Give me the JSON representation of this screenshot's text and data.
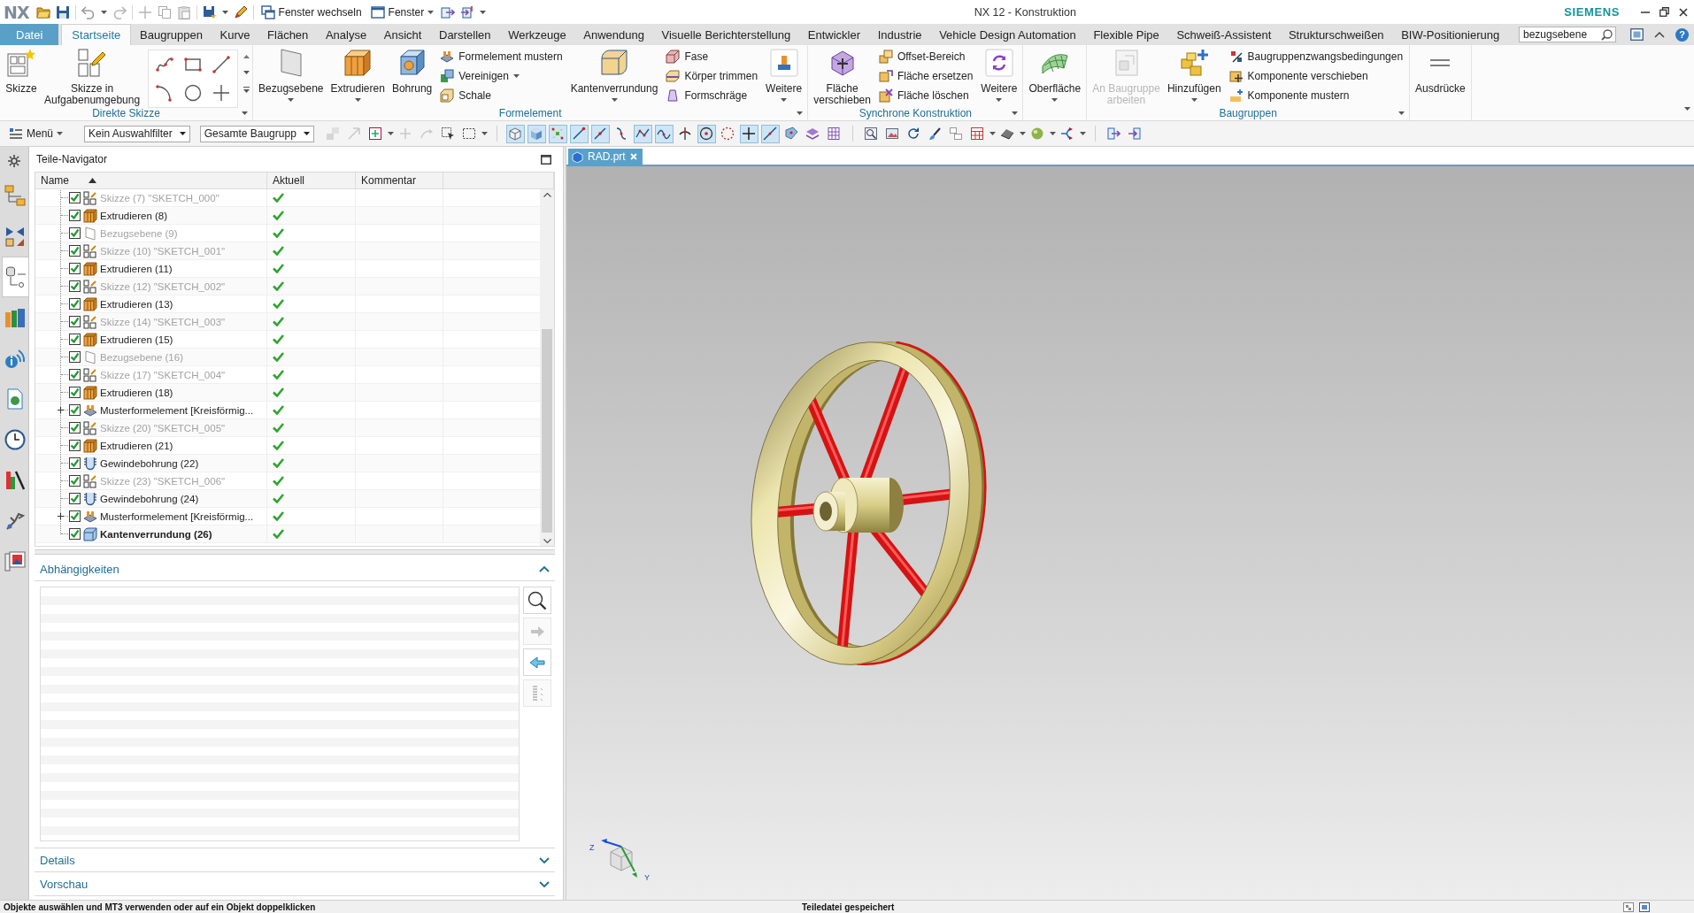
{
  "title_bar": {
    "logo": "NX",
    "quick_access": [
      {
        "label": "Fenster wechseln",
        "dropdown": false
      },
      {
        "label": "Fenster",
        "dropdown": true
      }
    ],
    "title": "NX 12 - Konstruktion",
    "brand": "SIEMENS"
  },
  "ribbon_tabs": [
    {
      "label": "Datei",
      "kind": "file",
      "selected": false
    },
    {
      "label": "Startseite",
      "kind": "tab",
      "selected": true
    },
    {
      "label": "Baugruppen",
      "kind": "tab",
      "selected": false
    },
    {
      "label": "Kurve",
      "kind": "tab",
      "selected": false
    },
    {
      "label": "Flächen",
      "kind": "tab",
      "selected": false
    },
    {
      "label": "Analyse",
      "kind": "tab",
      "selected": false
    },
    {
      "label": "Ansicht",
      "kind": "tab",
      "selected": false
    },
    {
      "label": "Darstellen",
      "kind": "tab",
      "selected": false
    },
    {
      "label": "Werkzeuge",
      "kind": "tab",
      "selected": false
    },
    {
      "label": "Anwendung",
      "kind": "tab",
      "selected": false
    },
    {
      "label": "Visuelle Berichterstellung",
      "kind": "tab",
      "selected": false
    },
    {
      "label": "Entwickler",
      "kind": "tab",
      "selected": false
    },
    {
      "label": "Industrie",
      "kind": "tab",
      "selected": false
    },
    {
      "label": "Vehicle Design Automation",
      "kind": "tab",
      "selected": false
    },
    {
      "label": "Flexible Pipe",
      "kind": "tab",
      "selected": false
    },
    {
      "label": "Schweiß-Assistent",
      "kind": "tab",
      "selected": false
    },
    {
      "label": "Strukturschweißen",
      "kind": "tab",
      "selected": false
    },
    {
      "label": "BIW-Positionierung",
      "kind": "tab",
      "selected": false
    }
  ],
  "command_search": {
    "value": "bezugsebene"
  },
  "help": "?",
  "ribbon_groups": [
    {
      "label": "Direkte Skizze",
      "launcher": true,
      "items": [
        {
          "kind": "large",
          "label": "Skizze",
          "dropdown": false,
          "disabled": false
        },
        {
          "kind": "large",
          "label": "Skizze in Aufgabenumgebung",
          "dropdown": false,
          "disabled": false
        },
        {
          "kind": "gallery"
        }
      ]
    },
    {
      "label": "Formelement",
      "launcher": true,
      "items": [
        {
          "kind": "large",
          "label": "Bezugsebene",
          "dropdown": true,
          "disabled": false
        },
        {
          "kind": "large",
          "label": "Extrudieren",
          "dropdown": true,
          "disabled": false
        },
        {
          "kind": "large",
          "label": "Bohrung",
          "dropdown": false,
          "disabled": false
        },
        {
          "kind": "stack",
          "entries": [
            {
              "label": "Formelement mustern",
              "dropdown": false
            },
            {
              "label": "Vereinigen",
              "dropdown": true
            },
            {
              "label": "Schale",
              "dropdown": false
            }
          ]
        },
        {
          "kind": "large",
          "label": "Kantenverrundung",
          "dropdown": true,
          "disabled": false
        },
        {
          "kind": "stack",
          "entries": [
            {
              "label": "Fase",
              "dropdown": false
            },
            {
              "label": "Körper trimmen",
              "dropdown": false
            },
            {
              "label": "Formschräge",
              "dropdown": false
            }
          ]
        },
        {
          "kind": "large",
          "label": "Weitere",
          "dropdown": true,
          "disabled": false
        }
      ]
    },
    {
      "label": "Synchrone Konstruktion",
      "launcher": true,
      "items": [
        {
          "kind": "large",
          "label": "Fläche verschieben",
          "dropdown": false,
          "disabled": false
        },
        {
          "kind": "stack",
          "entries": [
            {
              "label": "Offset-Bereich",
              "dropdown": false
            },
            {
              "label": "Fläche ersetzen",
              "dropdown": false
            },
            {
              "label": "Fläche löschen",
              "dropdown": false
            }
          ]
        },
        {
          "kind": "large",
          "label": "Weitere",
          "dropdown": true,
          "disabled": false
        }
      ]
    },
    {
      "launcher": false,
      "items": [
        {
          "kind": "large",
          "label": "Oberfläche",
          "dropdown": true,
          "disabled": false
        }
      ]
    },
    {
      "label": "Baugruppen",
      "launcher": true,
      "items": [
        {
          "kind": "large",
          "label": "An Baugruppe arbeiten",
          "dropdown": false,
          "disabled": true
        },
        {
          "kind": "large",
          "label": "Hinzufügen",
          "dropdown": true,
          "disabled": false
        },
        {
          "kind": "stack",
          "entries": [
            {
              "label": "Baugruppenzwangsbedingungen",
              "dropdown": false
            },
            {
              "label": "Komponente verschieben",
              "dropdown": false
            },
            {
              "label": "Komponente mustern",
              "dropdown": false
            }
          ]
        }
      ]
    },
    {
      "launcher": false,
      "items": [
        {
          "kind": "large",
          "label": "Ausdrücke",
          "dropdown": false,
          "disabled": false
        }
      ]
    }
  ],
  "selection_bar": {
    "menu": "Menü",
    "filters": [
      {
        "value": "Kein Auswahlfilter"
      },
      {
        "value": "Gesamte Baugrupp"
      }
    ],
    "tools": [
      {
        "on": false,
        "disabled": true,
        "dropdown": false
      },
      {
        "on": false,
        "disabled": true,
        "dropdown": false
      },
      {
        "on": false,
        "disabled": false,
        "dropdown": true
      },
      {
        "on": false,
        "disabled": true,
        "dropdown": false
      },
      {
        "on": false,
        "disabled": true,
        "dropdown": false
      },
      {
        "on": false,
        "disabled": false,
        "dropdown": false
      },
      {
        "on": false,
        "disabled": false,
        "dropdown": true
      },
      {
        "on": true,
        "disabled": false,
        "dropdown": false
      },
      {
        "on": true,
        "disabled": false,
        "dropdown": false
      },
      {
        "on": true,
        "disabled": false,
        "dropdown": false
      },
      {
        "on": true,
        "disabled": false,
        "dropdown": false
      },
      {
        "on": true,
        "disabled": false,
        "dropdown": false
      },
      {
        "on": false,
        "disabled": false,
        "dropdown": false
      },
      {
        "on": true,
        "disabled": false,
        "dropdown": false
      },
      {
        "on": true,
        "disabled": false,
        "dropdown": false
      },
      {
        "on": false,
        "disabled": false,
        "dropdown": false
      },
      {
        "on": true,
        "disabled": false,
        "dropdown": false
      },
      {
        "on": false,
        "disabled": false,
        "dropdown": false
      },
      {
        "on": true,
        "disabled": false,
        "dropdown": false
      },
      {
        "on": true,
        "disabled": false,
        "dropdown": false
      },
      {
        "on": false,
        "disabled": false,
        "dropdown": false
      },
      {
        "on": false,
        "disabled": false,
        "dropdown": false
      },
      {
        "on": false,
        "disabled": false,
        "dropdown": false
      },
      {
        "on": false,
        "disabled": false,
        "dropdown": false
      },
      {
        "on": false,
        "disabled": false,
        "dropdown": false
      },
      {
        "on": false,
        "disabled": false,
        "dropdown": false
      },
      {
        "on": false,
        "disabled": false,
        "dropdown": false
      },
      {
        "on": false,
        "disabled": false,
        "dropdown": false
      },
      {
        "on": false,
        "disabled": false,
        "dropdown": true
      },
      {
        "on": false,
        "disabled": false,
        "dropdown": true
      },
      {
        "on": false,
        "disabled": false,
        "dropdown": true
      },
      {
        "on": false,
        "disabled": false,
        "dropdown": true
      },
      {
        "on": false,
        "disabled": false,
        "dropdown": false
      },
      {
        "on": false,
        "disabled": false,
        "dropdown": false
      }
    ]
  },
  "resource_bar": {
    "tabs": [
      {
        "selected": false
      },
      {
        "selected": false
      },
      {
        "selected": true
      },
      {
        "selected": false
      },
      {
        "selected": false
      },
      {
        "selected": false
      },
      {
        "selected": false
      },
      {
        "selected": false
      },
      {
        "selected": false
      },
      {
        "selected": false
      }
    ]
  },
  "navigator": {
    "title": "Teile-Navigator",
    "columns": [
      {
        "label": "Name",
        "sorted": true
      },
      {
        "label": "Aktuell",
        "sorted": false
      },
      {
        "label": "Kommentar",
        "sorted": false
      }
    ],
    "rows": [
      {
        "name": "Skizze (7) \"SKETCH_000\"",
        "kind": "sketch",
        "checked": true,
        "dimmed": true,
        "current": false,
        "up_to_date": true,
        "collapsed": false
      },
      {
        "name": "Extrudieren (8)",
        "kind": "extrude",
        "checked": true,
        "dimmed": false,
        "current": false,
        "up_to_date": true,
        "collapsed": false
      },
      {
        "name": "Bezugsebene (9)",
        "kind": "datum",
        "checked": true,
        "dimmed": true,
        "current": false,
        "up_to_date": true,
        "collapsed": false
      },
      {
        "name": "Skizze (10) \"SKETCH_001\"",
        "kind": "sketch",
        "checked": true,
        "dimmed": true,
        "current": false,
        "up_to_date": true,
        "collapsed": false
      },
      {
        "name": "Extrudieren (11)",
        "kind": "extrude",
        "checked": true,
        "dimmed": false,
        "current": false,
        "up_to_date": true,
        "collapsed": false
      },
      {
        "name": "Skizze (12) \"SKETCH_002\"",
        "kind": "sketch",
        "checked": true,
        "dimmed": true,
        "current": false,
        "up_to_date": true,
        "collapsed": false
      },
      {
        "name": "Extrudieren (13)",
        "kind": "extrude",
        "checked": true,
        "dimmed": false,
        "current": false,
        "up_to_date": true,
        "collapsed": false
      },
      {
        "name": "Skizze (14) \"SKETCH_003\"",
        "kind": "sketch",
        "checked": true,
        "dimmed": true,
        "current": false,
        "up_to_date": true,
        "collapsed": false
      },
      {
        "name": "Extrudieren (15)",
        "kind": "extrude",
        "checked": true,
        "dimmed": false,
        "current": false,
        "up_to_date": true,
        "collapsed": false
      },
      {
        "name": "Bezugsebene (16)",
        "kind": "datum",
        "checked": true,
        "dimmed": true,
        "current": false,
        "up_to_date": true,
        "collapsed": false
      },
      {
        "name": "Skizze (17) \"SKETCH_004\"",
        "kind": "sketch",
        "checked": true,
        "dimmed": true,
        "current": false,
        "up_to_date": true,
        "collapsed": false
      },
      {
        "name": "Extrudieren (18)",
        "kind": "extrude",
        "checked": true,
        "dimmed": false,
        "current": false,
        "up_to_date": true,
        "collapsed": false
      },
      {
        "name": "Musterformelement [Kreisförmig...",
        "kind": "pattern",
        "checked": true,
        "dimmed": false,
        "current": false,
        "up_to_date": true,
        "collapsed": true
      },
      {
        "name": "Skizze (20) \"SKETCH_005\"",
        "kind": "sketch",
        "checked": true,
        "dimmed": true,
        "current": false,
        "up_to_date": true,
        "collapsed": false
      },
      {
        "name": "Extrudieren (21)",
        "kind": "extrude",
        "checked": true,
        "dimmed": false,
        "current": false,
        "up_to_date": true,
        "collapsed": false
      },
      {
        "name": "Gewindebohrung (22)",
        "kind": "thread_hole",
        "checked": true,
        "dimmed": false,
        "current": false,
        "up_to_date": true,
        "collapsed": false
      },
      {
        "name": "Skizze (23) \"SKETCH_006\"",
        "kind": "sketch",
        "checked": true,
        "dimmed": true,
        "current": false,
        "up_to_date": true,
        "collapsed": false
      },
      {
        "name": "Gewindebohrung (24)",
        "kind": "thread_hole",
        "checked": true,
        "dimmed": false,
        "current": false,
        "up_to_date": true,
        "collapsed": false
      },
      {
        "name": "Musterformelement [Kreisförmig...",
        "kind": "pattern",
        "checked": true,
        "dimmed": false,
        "current": false,
        "up_to_date": true,
        "collapsed": true
      },
      {
        "name": "Kantenverrundung (26)",
        "kind": "blend",
        "checked": true,
        "dimmed": false,
        "current": true,
        "up_to_date": true,
        "collapsed": false
      }
    ]
  },
  "panels": [
    {
      "title": "Abhängigkeiten",
      "expanded": true,
      "tools": [
        {
          "disabled": false
        },
        {
          "disabled": true
        },
        {
          "disabled": false
        },
        {
          "disabled": true
        }
      ]
    },
    {
      "title": "Details",
      "expanded": false
    },
    {
      "title": "Vorschau",
      "expanded": false
    }
  ],
  "viewport": {
    "tabs": [
      {
        "label": "RAD.prt",
        "selected": true
      }
    ],
    "triad_labels": [
      "Z",
      "Y"
    ]
  },
  "status_bar": {
    "prompt": "Objekte auswählen und MT3 verwenden oder auf ein Objekt doppelklicken",
    "message": "Teiledatei gespeichert"
  }
}
